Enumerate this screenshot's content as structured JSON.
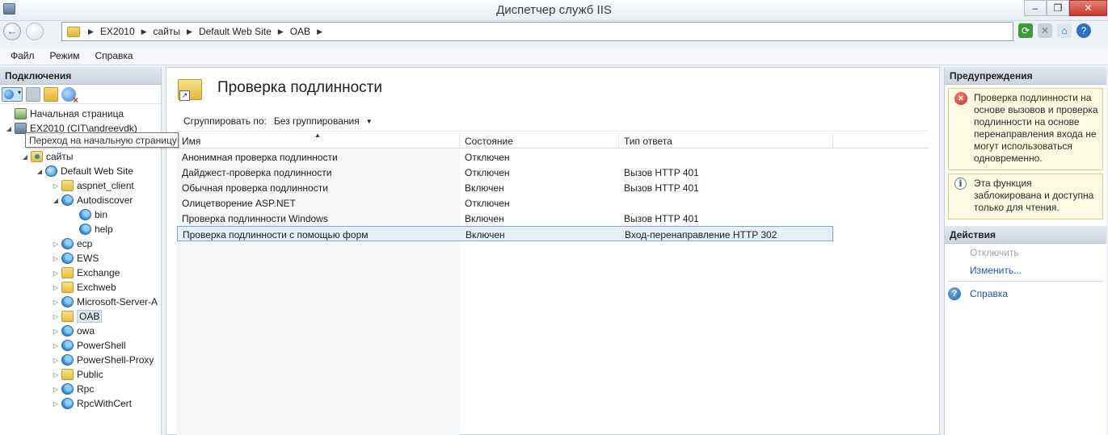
{
  "window": {
    "title": "Диспетчер служб IIS",
    "min": "–",
    "max": "❐",
    "close": "✕"
  },
  "address": {
    "crumbs": [
      "EX2010",
      "сайты",
      "Default Web Site",
      "OAB"
    ],
    "sep": "▶"
  },
  "toolbar_icons": {
    "refresh": "⟳",
    "stop": "✕",
    "home": "⌂",
    "help": "?"
  },
  "menu": [
    "Файл",
    "Режим",
    "Справка"
  ],
  "connections": {
    "title": "Подключения",
    "tooltip": "Переход на начальную страницу",
    "tree": [
      {
        "label": "Начальная страница",
        "icon": "home-start-icon",
        "expander": ""
      },
      {
        "label": "EX2010 (CIT\\andreevdk)",
        "icon": "server-icon",
        "expander": "◢"
      },
      {
        "label": "сайты",
        "icon": "sites-folder-icon",
        "expander": "◢"
      },
      {
        "label": "Default Web Site",
        "icon": "website-icon",
        "expander": "◢"
      },
      {
        "label": "aspnet_client",
        "icon": "folder-icon",
        "expander": "▷"
      },
      {
        "label": "Autodiscover",
        "icon": "application-icon",
        "expander": "◢"
      },
      {
        "label": "bin",
        "icon": "application-icon",
        "expander": ""
      },
      {
        "label": "help",
        "icon": "application-icon",
        "expander": ""
      },
      {
        "label": "ecp",
        "icon": "application-icon",
        "expander": "▷"
      },
      {
        "label": "EWS",
        "icon": "application-icon",
        "expander": "▷"
      },
      {
        "label": "Exchange",
        "icon": "folder-icon",
        "expander": "▷"
      },
      {
        "label": "Exchweb",
        "icon": "folder-icon",
        "expander": "▷"
      },
      {
        "label": "Microsoft-Server-A",
        "icon": "application-icon",
        "expander": "▷"
      },
      {
        "label": "OAB",
        "icon": "folder-icon",
        "expander": "▷"
      },
      {
        "label": "owa",
        "icon": "application-icon",
        "expander": "▷"
      },
      {
        "label": "PowerShell",
        "icon": "application-icon",
        "expander": "▷"
      },
      {
        "label": "PowerShell-Proxy",
        "icon": "application-icon",
        "expander": "▷"
      },
      {
        "label": "Public",
        "icon": "folder-icon",
        "expander": "▷"
      },
      {
        "label": "Rpc",
        "icon": "application-icon",
        "expander": "▷"
      },
      {
        "label": "RpcWithCert",
        "icon": "application-icon",
        "expander": "▷"
      }
    ]
  },
  "feature": {
    "title": "Проверка подлинности",
    "group_label": "Сгруппировать по:",
    "group_value": "Без группирования",
    "group_caret": "▼",
    "sort_arrow": "▲",
    "columns": [
      "Имя",
      "Состояние",
      "Тип ответа"
    ],
    "rows": [
      [
        "Анонимная проверка подлинности",
        "Отключен",
        ""
      ],
      [
        "Дайджест-проверка подлинности",
        "Отключен",
        "Вызов HTTP 401"
      ],
      [
        "Обычная проверка подлинности",
        "Включен",
        "Вызов HTTP 401"
      ],
      [
        "Олицетворение ASP.NET",
        "Отключен",
        ""
      ],
      [
        "Проверка подлинности Windows",
        "Включен",
        "Вызов HTTP 401"
      ],
      [
        "Проверка подлинности с помощью форм",
        "Включен",
        "Вход-перенаправление HTTP 302"
      ]
    ],
    "selected_row": 5
  },
  "alerts": {
    "title": "Предупреждения",
    "warning": "Проверка подлинности на основе вызовов и проверка подлинности на основе перенаправления входа не могут использоваться одновременно.",
    "info": "Эта функция заблокирована и доступна только для чтения."
  },
  "actions": {
    "title": "Действия",
    "disable": "Отключить",
    "edit": "Изменить...",
    "help": "Справка"
  }
}
